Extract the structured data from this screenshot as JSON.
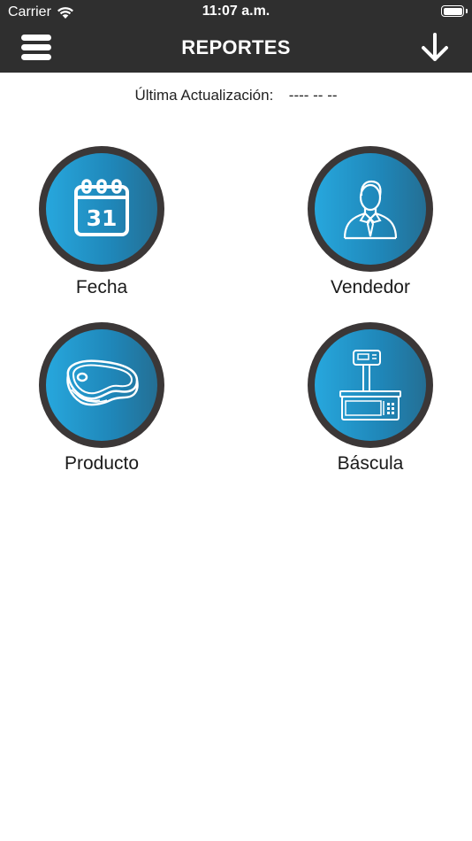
{
  "status_bar": {
    "carrier": "Carrier",
    "time": "11:07 a.m."
  },
  "nav": {
    "title": "REPORTES"
  },
  "last_update": {
    "label": "Última Actualización:",
    "value": "---- -- --"
  },
  "tiles": [
    {
      "label": "Fecha",
      "icon": "calendar-icon",
      "calendar_day": "31"
    },
    {
      "label": "Vendedor",
      "icon": "salesperson-icon"
    },
    {
      "label": "Producto",
      "icon": "meat-steak-icon"
    },
    {
      "label": "Báscula",
      "icon": "scale-icon"
    }
  ],
  "colors": {
    "header_bg": "#2f2f2f",
    "circle_ring": "#3b3737",
    "circle_gradient_start": "#27a7dd",
    "circle_gradient_end": "#246f94"
  }
}
